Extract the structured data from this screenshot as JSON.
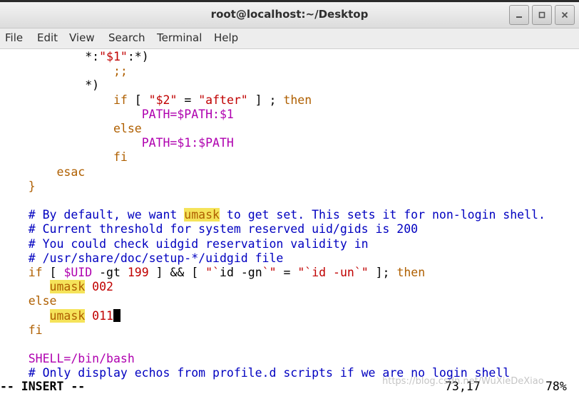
{
  "window": {
    "title": "root@localhost:~/Desktop",
    "buttons": [
      {
        "name": "minimize",
        "glyph": "–"
      },
      {
        "name": "maximize",
        "glyph": "□"
      },
      {
        "name": "close",
        "glyph": "✕"
      }
    ]
  },
  "menu": [
    "File",
    "Edit",
    "View",
    "Search",
    "Terminal",
    "Help"
  ],
  "colors": {
    "keyword": "#af5f00",
    "string": "#c00000",
    "variable": "#af00af",
    "comment": "#0000c0",
    "highlight": "#f5e35a"
  },
  "editor": {
    "lines": [
      [
        {
          "t": "            *:"
        },
        {
          "t": "\"$1\"",
          "c": "str"
        },
        {
          "t": ":*)"
        }
      ],
      [
        {
          "t": "                ;;",
          "c": "kw"
        }
      ],
      [
        {
          "t": "            *)"
        }
      ],
      [
        {
          "t": "                "
        },
        {
          "t": "if",
          "c": "kw"
        },
        {
          "t": " [ "
        },
        {
          "t": "\"$2\"",
          "c": "str"
        },
        {
          "t": " = "
        },
        {
          "t": "\"after\"",
          "c": "str"
        },
        {
          "t": " ] ; "
        },
        {
          "t": "then",
          "c": "kw"
        }
      ],
      [
        {
          "t": "                    "
        },
        {
          "t": "PATH=$PATH:$1",
          "c": "var"
        }
      ],
      [
        {
          "t": "                "
        },
        {
          "t": "else",
          "c": "kw"
        }
      ],
      [
        {
          "t": "                    "
        },
        {
          "t": "PATH=$1:$PATH",
          "c": "var"
        }
      ],
      [
        {
          "t": "                "
        },
        {
          "t": "fi",
          "c": "kw"
        }
      ],
      [
        {
          "t": "        "
        },
        {
          "t": "esac",
          "c": "kw"
        }
      ],
      [
        {
          "t": "    "
        },
        {
          "t": "}",
          "c": "kw"
        }
      ],
      [
        {
          "t": ""
        }
      ],
      [
        {
          "t": "    # By default, we want ",
          "c": "cmt"
        },
        {
          "t": "umask",
          "c": "hl"
        },
        {
          "t": " to get set. This sets it for non-login shell.",
          "c": "cmt"
        }
      ],
      [
        {
          "t": "    # Current threshold for system reserved uid/gids is 200",
          "c": "cmt"
        }
      ],
      [
        {
          "t": "    # You could check uidgid reservation validity in",
          "c": "cmt"
        }
      ],
      [
        {
          "t": "    # /usr/share/doc/setup-*/uidgid file",
          "c": "cmt"
        }
      ],
      [
        {
          "t": "    "
        },
        {
          "t": "if",
          "c": "kw"
        },
        {
          "t": " [ "
        },
        {
          "t": "$UID",
          "c": "var"
        },
        {
          "t": " -gt "
        },
        {
          "t": "199",
          "c": "num"
        },
        {
          "t": " ] && [ "
        },
        {
          "t": "\"`",
          "c": "str"
        },
        {
          "t": "id -gn"
        },
        {
          "t": "`\"",
          "c": "str"
        },
        {
          "t": " = "
        },
        {
          "t": "\"`",
          "c": "str"
        },
        {
          "t": "id -un",
          "c": "str"
        },
        {
          "t": "`\"",
          "c": "str"
        },
        {
          "t": " ]; "
        },
        {
          "t": "then",
          "c": "kw"
        }
      ],
      [
        {
          "t": "       "
        },
        {
          "t": "umask",
          "c": "hl"
        },
        {
          "t": " "
        },
        {
          "t": "002",
          "c": "num"
        }
      ],
      [
        {
          "t": "    "
        },
        {
          "t": "else",
          "c": "kw"
        }
      ],
      [
        {
          "t": "       "
        },
        {
          "t": "umask",
          "c": "hl"
        },
        {
          "t": " "
        },
        {
          "t": "011",
          "c": "num"
        },
        {
          "cursor": true
        }
      ],
      [
        {
          "t": "    "
        },
        {
          "t": "fi",
          "c": "kw"
        }
      ],
      [
        {
          "t": ""
        }
      ],
      [
        {
          "t": "    "
        },
        {
          "t": "SHELL=/bin/bash",
          "c": "var"
        }
      ],
      [
        {
          "t": "    # Only display echos from profile.d scripts if we are no login shell",
          "c": "cmt"
        }
      ]
    ]
  },
  "status": {
    "mode": "-- INSERT --",
    "position": "73,17",
    "percent": "78%"
  },
  "watermark": "https://blog.csdn.net/WuXieDeXiao"
}
